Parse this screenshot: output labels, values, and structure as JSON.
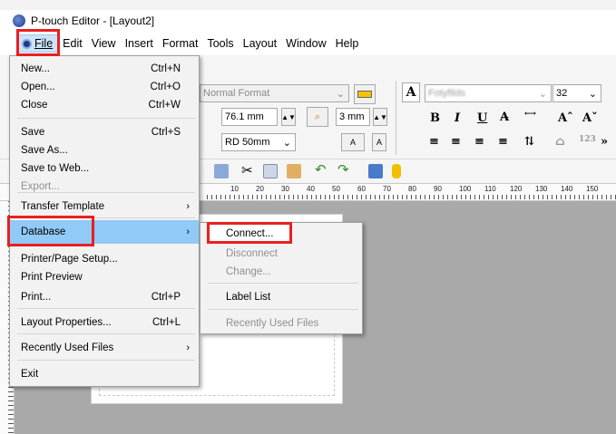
{
  "window": {
    "title": "P-touch Editor - [Layout2]"
  },
  "menubar": [
    {
      "label": "File",
      "active": true
    },
    {
      "label": "Edit"
    },
    {
      "label": "View"
    },
    {
      "label": "Insert"
    },
    {
      "label": "Format"
    },
    {
      "label": "Tools"
    },
    {
      "label": "Layout"
    },
    {
      "label": "Window"
    },
    {
      "label": "Help"
    }
  ],
  "ribbon": {
    "format_select": "Normal Format",
    "width_value": "76.1 mm",
    "margin_value": "3 mm",
    "tape_select": "RD 50mm",
    "font_name": "Fotyfilds",
    "font_size": "32",
    "bold": "B",
    "italic": "I",
    "underline": "U"
  },
  "ruler_numbers": [
    "10",
    "20",
    "30",
    "40",
    "50",
    "60",
    "70",
    "80",
    "90",
    "100",
    "110",
    "120",
    "130",
    "140",
    "150"
  ],
  "file_menu": {
    "items": [
      {
        "label": "New...",
        "shortcut": "Ctrl+N"
      },
      {
        "label": "Open...",
        "shortcut": "Ctrl+O"
      },
      {
        "label": "Close",
        "shortcut": "Ctrl+W"
      },
      {
        "label": "Save",
        "shortcut": "Ctrl+S"
      },
      {
        "label": "Save As...",
        "shortcut": ""
      },
      {
        "label": "Save to Web...",
        "shortcut": ""
      },
      {
        "label": "Export...",
        "shortcut": "",
        "disabled": true
      },
      {
        "label": "Transfer Template",
        "shortcut": "",
        "submenu": true
      },
      {
        "label": "Database",
        "shortcut": "",
        "submenu": true,
        "highlight": true
      },
      {
        "label": "Printer/Page Setup...",
        "shortcut": ""
      },
      {
        "label": "Print Preview",
        "shortcut": ""
      },
      {
        "label": "Print...",
        "shortcut": "Ctrl+P"
      },
      {
        "label": "Layout Properties...",
        "shortcut": "Ctrl+L"
      },
      {
        "label": "Recently Used Files",
        "shortcut": "",
        "submenu": true
      },
      {
        "label": "Exit",
        "shortcut": ""
      }
    ]
  },
  "database_menu": {
    "items": [
      {
        "label": "Connect...",
        "disabled": false
      },
      {
        "label": "Disconnect",
        "disabled": true
      },
      {
        "label": "Change...",
        "disabled": true
      },
      {
        "label": "Label List",
        "disabled": false
      },
      {
        "label": "Recently Used Files",
        "disabled": true
      }
    ]
  },
  "colors": {
    "highlight": "#91c9f7",
    "annotation_red": "#e8201f"
  }
}
